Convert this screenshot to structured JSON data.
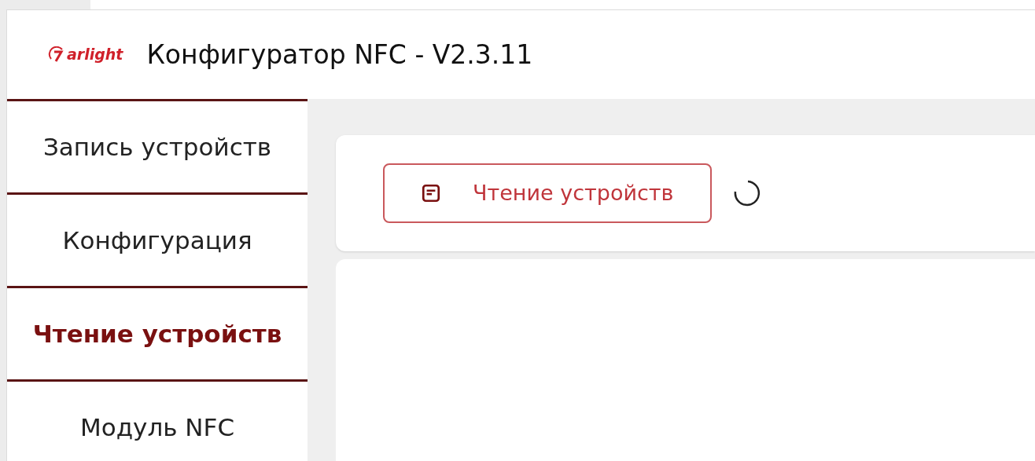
{
  "header": {
    "logo": "arlight",
    "title": "Конфигуратор NFC - V2.3.11"
  },
  "sidebar": {
    "items": [
      {
        "label": "Запись устройств",
        "selected": false
      },
      {
        "label": "Конфигурация",
        "selected": false
      },
      {
        "label": "Чтение устройств",
        "selected": true
      },
      {
        "label": "Модуль NFC",
        "selected": false
      }
    ]
  },
  "toolbar": {
    "button": "Чтение устройств",
    "loading": true
  }
}
